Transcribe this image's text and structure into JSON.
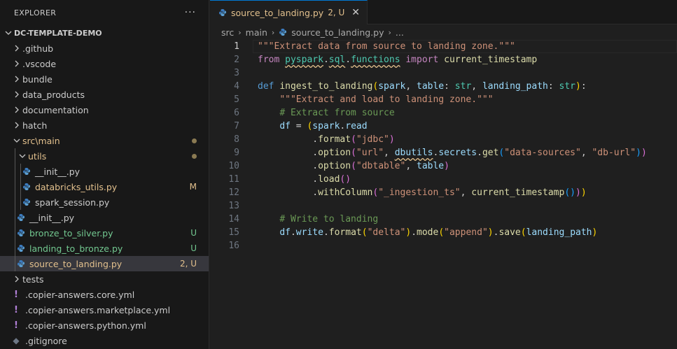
{
  "explorer": {
    "title": "EXPLORER",
    "more": "···",
    "root": "DC-TEMPLATE-DEMO",
    "items": [
      {
        "label": ".github"
      },
      {
        "label": ".vscode"
      },
      {
        "label": "bundle"
      },
      {
        "label": "data_products"
      },
      {
        "label": "documentation"
      },
      {
        "label": "hatch"
      },
      {
        "label": "src\\main"
      },
      {
        "label": "utils"
      },
      {
        "label": "__init__.py"
      },
      {
        "label": "databricks_utils.py",
        "status": "M"
      },
      {
        "label": "spark_session.py"
      },
      {
        "label": "__init__.py"
      },
      {
        "label": "bronze_to_silver.py",
        "status": "U"
      },
      {
        "label": "landing_to_bronze.py",
        "status": "U"
      },
      {
        "label": "source_to_landing.py",
        "status": "2, U"
      },
      {
        "label": "tests"
      },
      {
        "label": ".copier-answers.core.yml"
      },
      {
        "label": ".copier-answers.marketplace.yml"
      },
      {
        "label": ".copier-answers.python.yml"
      },
      {
        "label": ".gitignore"
      }
    ]
  },
  "tab": {
    "name": "source_to_landing.py",
    "status": "2, U",
    "close": "✕"
  },
  "breadcrumb": {
    "p1": "src",
    "p2": "main",
    "p3": "source_to_landing.py",
    "p4": "..."
  },
  "line_numbers": [
    "1",
    "2",
    "3",
    "4",
    "5",
    "6",
    "7",
    "8",
    "9",
    "10",
    "11",
    "12",
    "13",
    "14",
    "15",
    "16"
  ],
  "colors": {
    "accent": "#0078d4",
    "modified": "#e2c08d",
    "untracked": "#73c991"
  }
}
